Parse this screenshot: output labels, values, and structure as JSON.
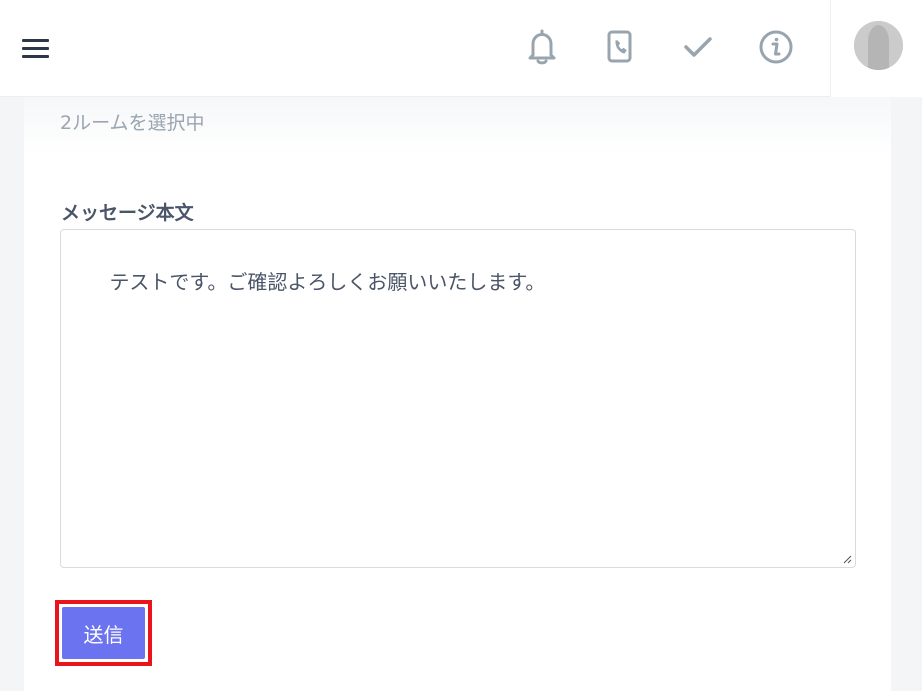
{
  "header": {
    "icons": [
      "menu-icon",
      "bell-icon",
      "phone-book-icon",
      "check-icon",
      "info-icon"
    ]
  },
  "colors": {
    "accent": "#6c73f0",
    "highlight_outline": "#e8151b",
    "icon_gray": "#98a4ae"
  },
  "main": {
    "selected_rooms_text": "2ルームを選択中",
    "message_label": "メッセージ本文",
    "message_value": "テストです。ご確認よろしくお願いいたします。",
    "send_label": "送信"
  }
}
